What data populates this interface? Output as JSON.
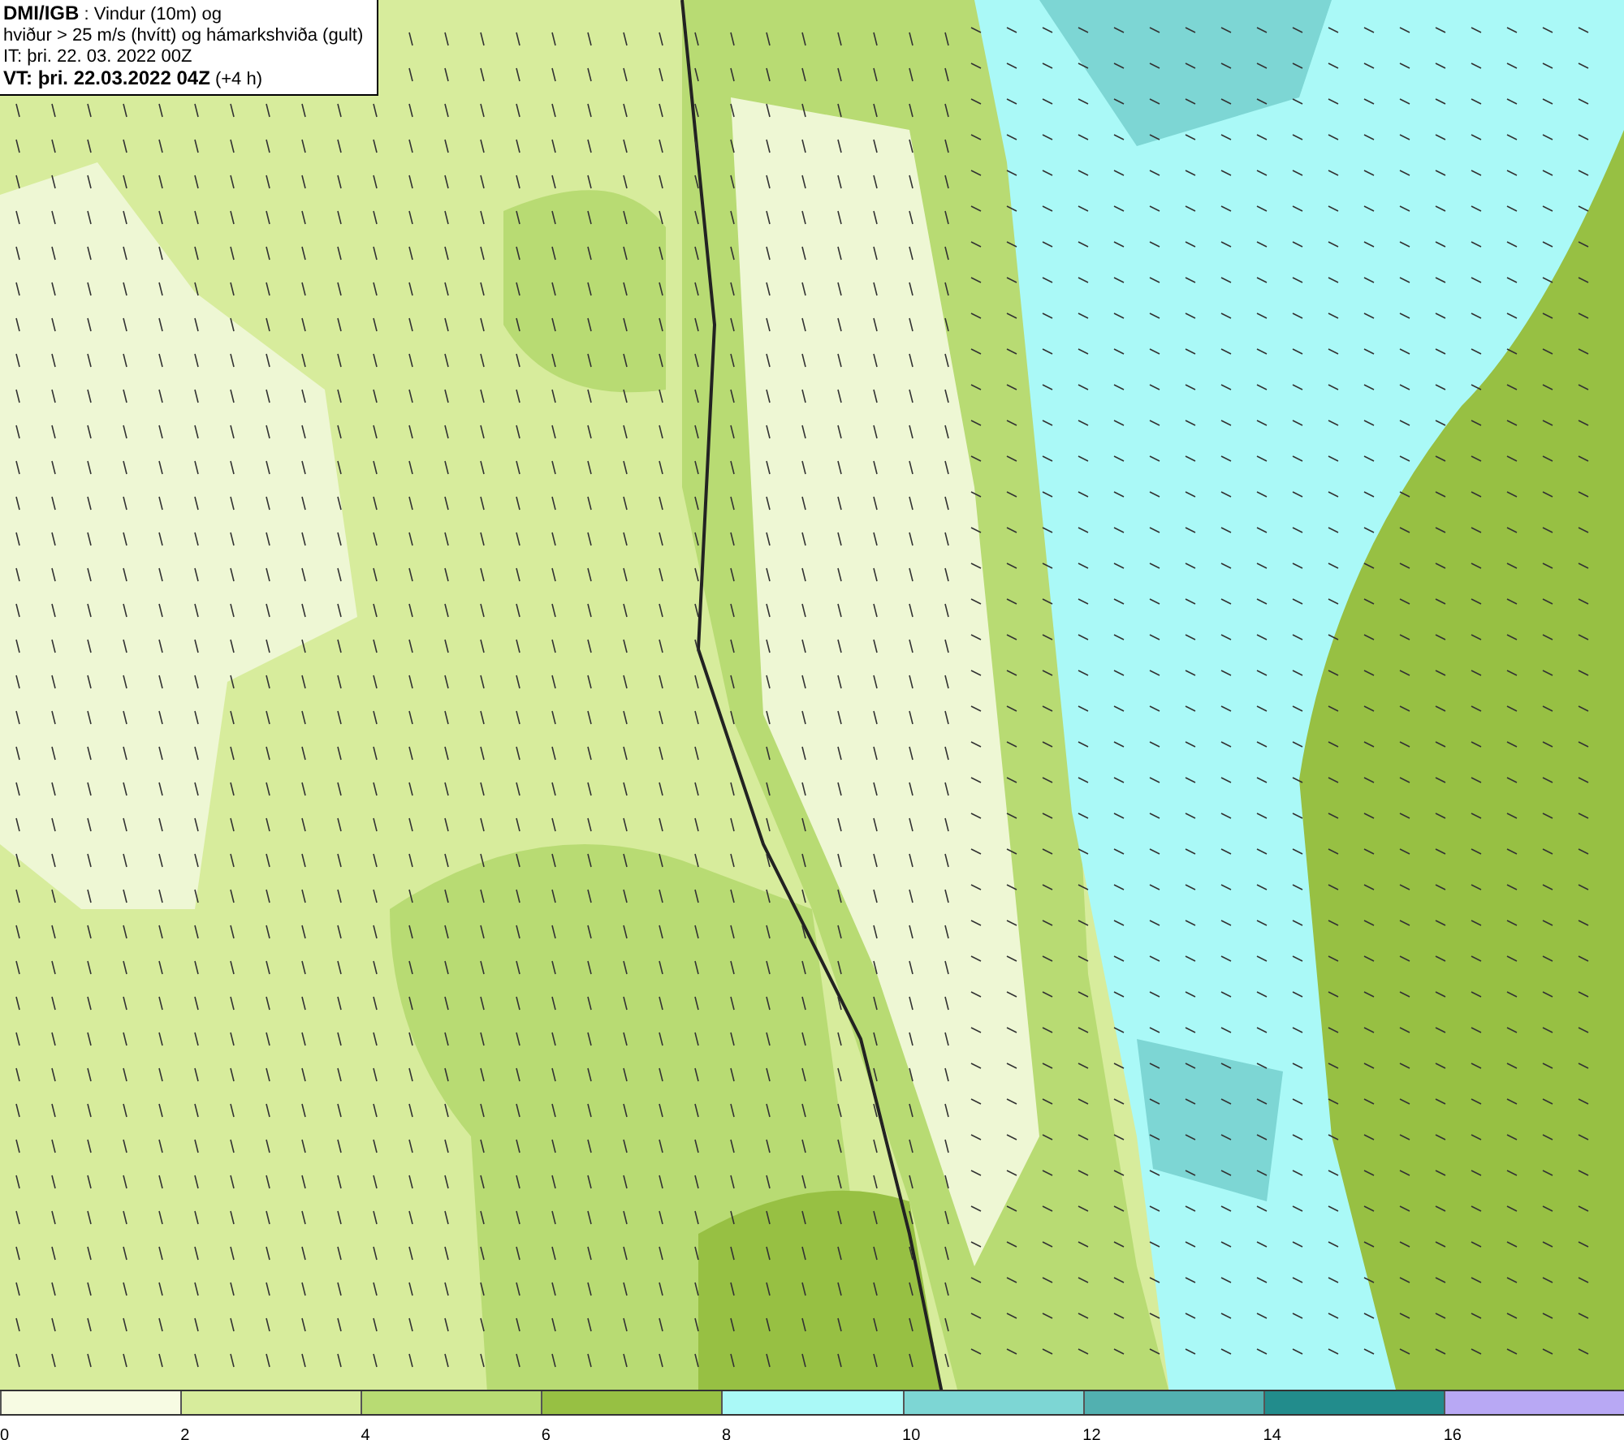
{
  "header": {
    "lines": [
      "**DMI/IGB** : Vindur (10m) og",
      "hviður > 25 m/s (hvítt) og hámarkshviða (gult)",
      "IT: þri. 22. 03. 2022 00Z",
      "**VT: þri. 22.03.2022 04Z** (+4 h)"
    ]
  },
  "legend": [
    {
      "label": "0",
      "color": "#f7fbe3"
    },
    {
      "label": "2",
      "color": "#d7ec9c"
    },
    {
      "label": "4",
      "color": "#b8db73"
    },
    {
      "label": "6",
      "color": "#97c043"
    },
    {
      "label": "8",
      "color": "#aaf9f7"
    },
    {
      "label": "10",
      "color": "#7dd6d4"
    },
    {
      "label": "12",
      "color": "#52b0b0"
    },
    {
      "label": "14",
      "color": "#228c8c"
    },
    {
      "label": "16",
      "color": "#b8a8f4"
    }
  ]
}
